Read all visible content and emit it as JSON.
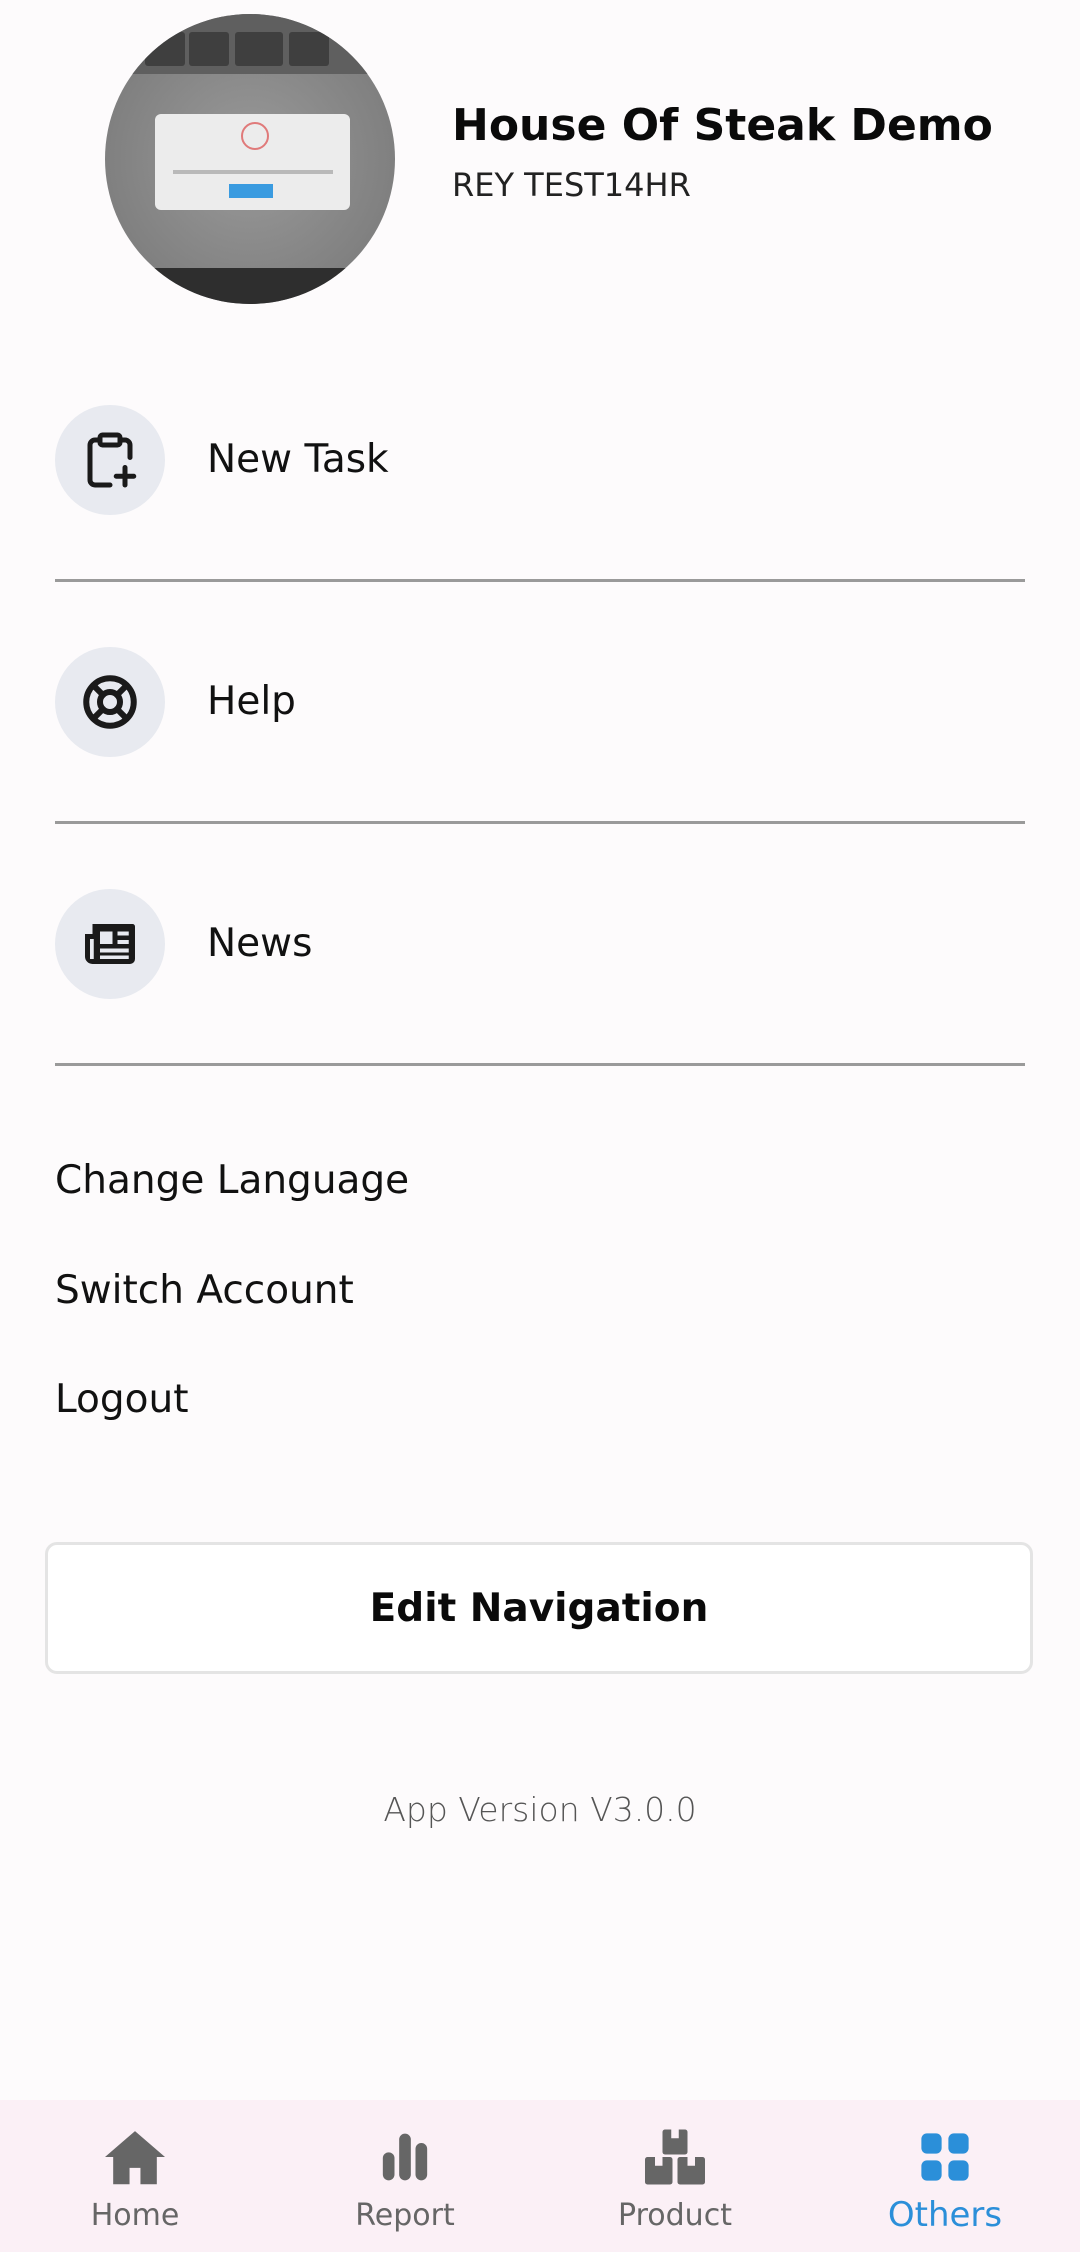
{
  "profile": {
    "store_name": "House Of Steak Demo",
    "user_name": "REY TEST14HR"
  },
  "menu": {
    "items": [
      {
        "label": "New Task",
        "icon": "clipboard-plus-icon"
      },
      {
        "label": "Help",
        "icon": "lifebuoy-icon"
      },
      {
        "label": "News",
        "icon": "newspaper-icon"
      }
    ]
  },
  "links": {
    "change_language": "Change Language",
    "switch_account": "Switch Account",
    "logout": "Logout"
  },
  "edit_navigation_label": "Edit Navigation",
  "app_version": "App Version V3.0.0",
  "bottom_nav": {
    "items": [
      {
        "label": "Home",
        "icon": "home-icon",
        "active": false
      },
      {
        "label": "Report",
        "icon": "bar-chart-icon",
        "active": false
      },
      {
        "label": "Product",
        "icon": "boxes-icon",
        "active": false
      },
      {
        "label": "Others",
        "icon": "grid-icon",
        "active": true
      }
    ]
  },
  "colors": {
    "active": "#2B8FD9",
    "inactive": "#666666",
    "icon_circle": "#E8EAF0",
    "nav_background": "#FBF0F6"
  }
}
